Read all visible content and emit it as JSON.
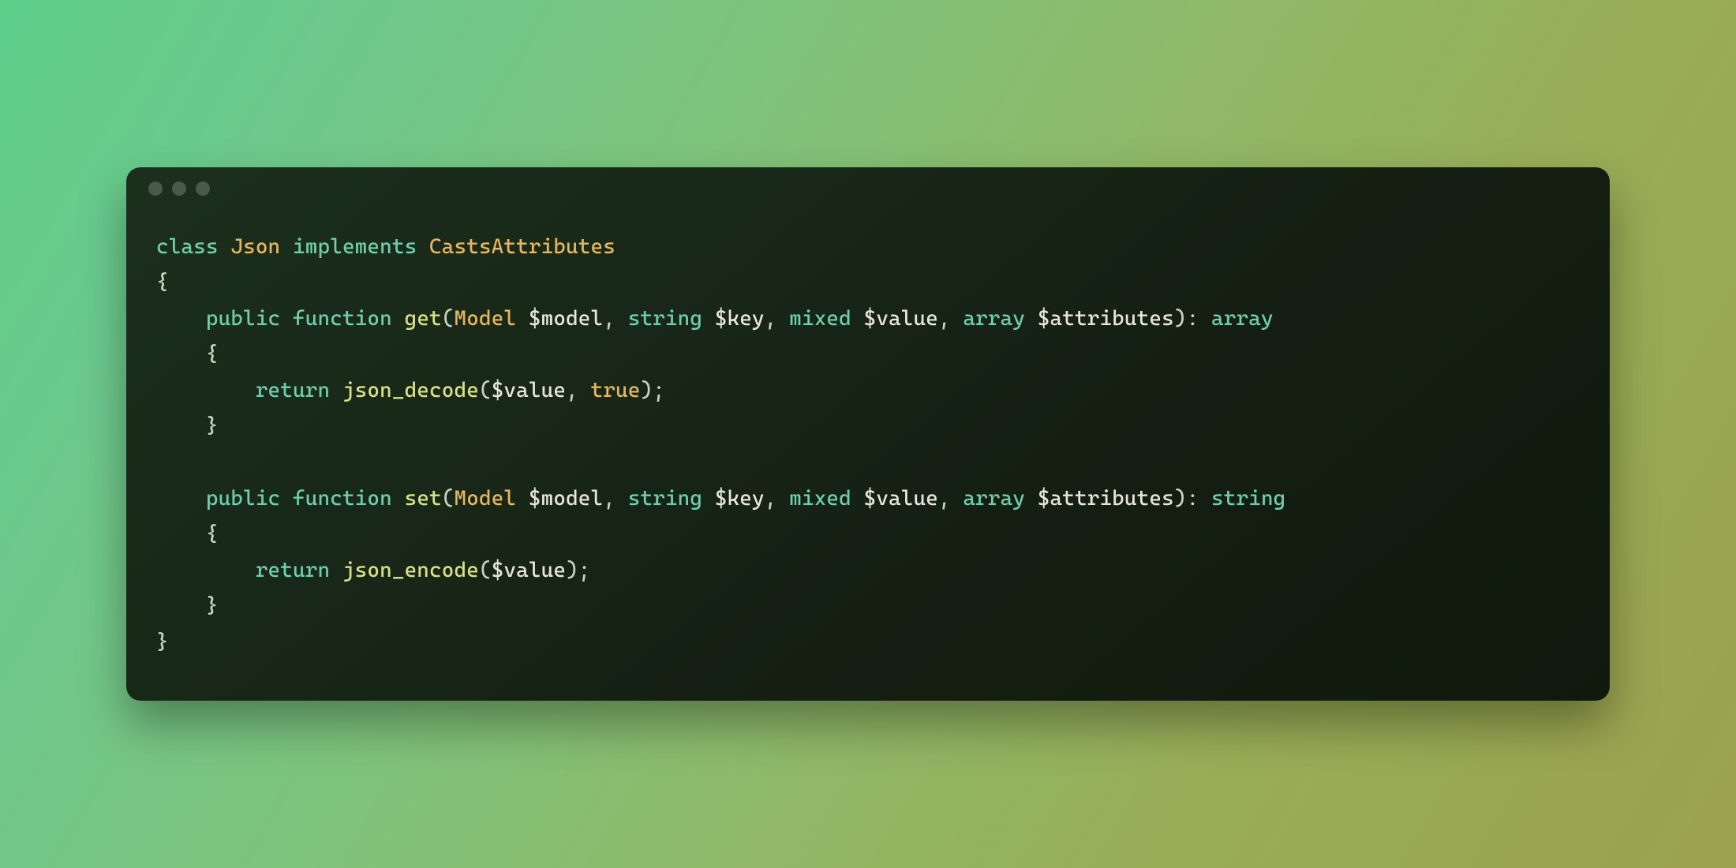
{
  "code": {
    "line1": {
      "kw_class": "class",
      "class_name": "Json",
      "kw_implements": "implements",
      "interface": "CastsAttributes"
    },
    "brace_open": "{",
    "method_get": {
      "kw_public": "public",
      "kw_function": "function",
      "name": "get",
      "paren_open": "(",
      "p1_type": "Model",
      "p1_var": "$model",
      "comma1": ", ",
      "p2_type": "string",
      "p2_var": "$key",
      "comma2": ", ",
      "p3_type": "mixed",
      "p3_var": "$value",
      "comma3": ", ",
      "p4_type": "array",
      "p4_var": "$attributes",
      "paren_close": ")",
      "colon": ": ",
      "return_type": "array",
      "body_open": "{",
      "kw_return": "return",
      "call": "json_decode",
      "call_paren_open": "(",
      "arg1": "$value",
      "arg_comma": ", ",
      "arg2": "true",
      "call_paren_close": ")",
      "semi": ";",
      "body_close": "}"
    },
    "method_set": {
      "kw_public": "public",
      "kw_function": "function",
      "name": "set",
      "paren_open": "(",
      "p1_type": "Model",
      "p1_var": "$model",
      "comma1": ", ",
      "p2_type": "string",
      "p2_var": "$key",
      "comma2": ", ",
      "p3_type": "mixed",
      "p3_var": "$value",
      "comma3": ", ",
      "p4_type": "array",
      "p4_var": "$attributes",
      "paren_close": ")",
      "colon": ": ",
      "return_type": "string",
      "body_open": "{",
      "kw_return": "return",
      "call": "json_encode",
      "call_paren_open": "(",
      "arg1": "$value",
      "call_paren_close": ")",
      "semi": ";",
      "body_close": "}"
    },
    "brace_close": "}"
  }
}
